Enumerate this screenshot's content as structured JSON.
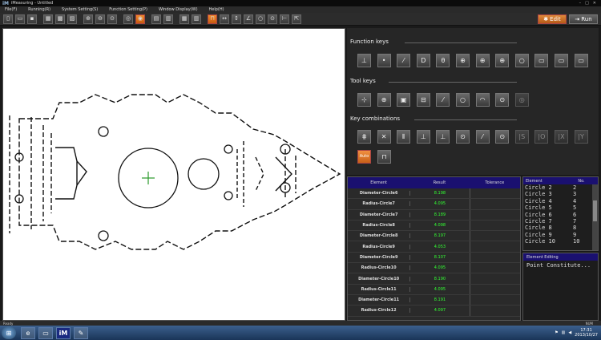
{
  "window": {
    "app_icon": "iM",
    "title": "iMeasuring - Untitled"
  },
  "menu": [
    "File(F)",
    "Running(R)",
    "System Setting(S)",
    "Function Setting(P)",
    "Window Display(W)",
    "Help(H)"
  ],
  "header_buttons": {
    "edit_label": "Edit",
    "run_label": "Run"
  },
  "function_keys": {
    "label": "Function keys",
    "glyphs": [
      "⊥",
      "•",
      "⁄",
      "D",
      "θ",
      "⊕",
      "⊕",
      "⊕",
      "○",
      "▭",
      "▭",
      "▭"
    ]
  },
  "tool_keys": {
    "label": "Tool keys",
    "glyphs": [
      "⊹",
      "⊕",
      "▣",
      "⊟",
      "⁄",
      "○",
      "◠",
      "⊙",
      "◎"
    ]
  },
  "key_combinations": {
    "label": "Key combinations",
    "glyphs": [
      "⋕",
      "✕",
      "⦀",
      "⊥",
      "⊥",
      "⊙",
      "⁄",
      "⊙",
      "|S",
      "|O",
      "|X",
      "|Y"
    ],
    "auto_label": "Auto"
  },
  "results_table": {
    "headers": [
      "Element",
      "Result",
      "Tolerance"
    ],
    "rows": [
      {
        "element": "Diameter-Circle6",
        "result": "8.198"
      },
      {
        "element": "Radius-Circle7",
        "result": "4.095"
      },
      {
        "element": "Diameter-Circle7",
        "result": "8.189"
      },
      {
        "element": "Radius-Circle8",
        "result": "4.098"
      },
      {
        "element": "Diameter-Circle8",
        "result": "8.197"
      },
      {
        "element": "Radius-Circle9",
        "result": "4.053"
      },
      {
        "element": "Diameter-Circle9",
        "result": "8.107"
      },
      {
        "element": "Radius-Circle10",
        "result": "4.095"
      },
      {
        "element": "Diameter-Circle10",
        "result": "8.190"
      },
      {
        "element": "Radius-Circle11",
        "result": "4.095"
      },
      {
        "element": "Diameter-Circle11",
        "result": "8.191"
      },
      {
        "element": "Radius-Circle12",
        "result": "4.097"
      }
    ]
  },
  "element_list": {
    "headers": [
      "Element",
      "No."
    ],
    "rows": [
      {
        "name": "Circle 2",
        "no": "2"
      },
      {
        "name": "Circle 3",
        "no": "3"
      },
      {
        "name": "Circle 4",
        "no": "4"
      },
      {
        "name": "Circle 5",
        "no": "5"
      },
      {
        "name": "Circle 6",
        "no": "6"
      },
      {
        "name": "Circle 7",
        "no": "7"
      },
      {
        "name": "Circle 8",
        "no": "8"
      },
      {
        "name": "Circle 9",
        "no": "9"
      },
      {
        "name": "Circle 10",
        "no": "10"
      }
    ]
  },
  "element_editing": {
    "header": "Element Editing",
    "text": "Point Constitute..."
  },
  "status": {
    "text": "Ready",
    "num": "NUM"
  },
  "taskbar": {
    "time": "17:31",
    "date": "2013/10/27"
  }
}
